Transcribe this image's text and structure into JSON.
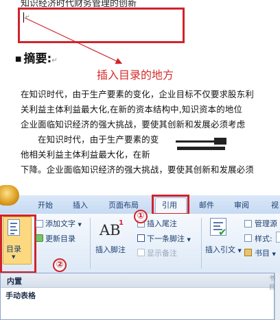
{
  "document": {
    "title_partial": "知识经济时代财务管理的创新",
    "abstract_heading": "摘要:",
    "annotation": "插入目录的地方",
    "paragraph_lines": [
      "在知识时代，由于生产要素的变化，企业目标不仅要求股东利",
      "关利益主体利益最大化,在新的资本结构中,知识资本的地位",
      "企业面临知识经济的强大挑战，要使其创新和发展必须考虑",
      "　　在知识时代，由于生产要素的变　　　　　　要求股",
      "他相关利益主体利益最大化，在新　　　　　　　资本的",
      "下降。企业面临知识经济的强大挑战，要使其创新和发展必须"
    ]
  },
  "ribbon": {
    "tabs": [
      "开始",
      "插入",
      "页面布局",
      "引用",
      "邮件",
      "审阅",
      "视"
    ],
    "active_tab": "引用",
    "toc_group": {
      "toc_button": "目录",
      "add_text": "添加文字",
      "update_toc": "更新目录"
    },
    "footnote_group": {
      "insert_footnote": "插入脚注",
      "insert_endnote": "插入尾注",
      "next_footnote": "下一条脚注",
      "show_notes": "显示备注"
    },
    "citation_group": {
      "insert_citation": "插入引文",
      "manage_sources": "管理源",
      "style": "样式:",
      "bibliography": "书目"
    }
  },
  "callouts": {
    "step1": "①",
    "step2": "②"
  },
  "dropdown": {
    "header": "内置",
    "item": "手动表格",
    "edge_text": "书目"
  },
  "colors": {
    "highlight_red": "#d0232a",
    "annotation_red": "#d42b2b",
    "ribbon_blue": "#dbe8f8"
  }
}
